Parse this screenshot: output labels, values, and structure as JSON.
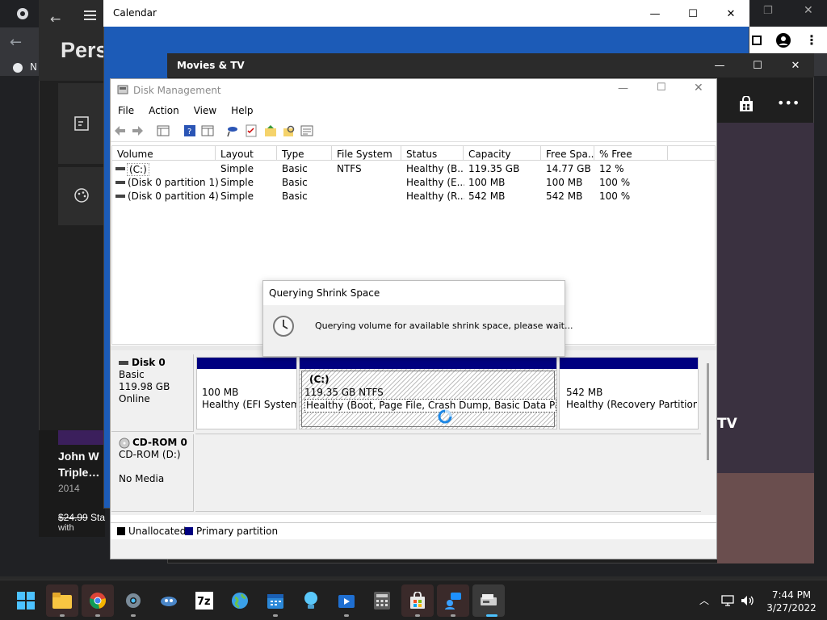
{
  "background": {
    "settings_title": "Pers",
    "settings_nav_letter": "N",
    "movie_card": {
      "title_line1": "John W",
      "title_line2": "Triple…",
      "year": "2014",
      "price": "$24.99",
      "price_suffix": "Sta",
      "with": "with"
    }
  },
  "calendar": {
    "title": "Calendar"
  },
  "movies": {
    "title": "Movies & TV",
    "poster_text": "TV"
  },
  "disk_management": {
    "title": "Disk Management",
    "menu": [
      "File",
      "Action",
      "View",
      "Help"
    ],
    "columns": [
      "Volume",
      "Layout",
      "Type",
      "File System",
      "Status",
      "Capacity",
      "Free Spa...",
      "% Free"
    ],
    "rows": [
      [
        "(C:)",
        "Simple",
        "Basic",
        "NTFS",
        "Healthy (B...",
        "119.35 GB",
        "14.77 GB",
        "12 %"
      ],
      [
        "(Disk 0 partition 1)",
        "Simple",
        "Basic",
        "",
        "Healthy (E...",
        "100 MB",
        "100 MB",
        "100 %"
      ],
      [
        "(Disk 0 partition 4)",
        "Simple",
        "Basic",
        "",
        "Healthy (R...",
        "542 MB",
        "542 MB",
        "100 %"
      ]
    ],
    "disk0": {
      "name": "Disk 0",
      "type": "Basic",
      "size": "119.98 GB",
      "state": "Online",
      "partitions": [
        {
          "size": "100 MB",
          "status": "Healthy (EFI System P"
        },
        {
          "label": "(C:)",
          "size": "119.35 GB NTFS",
          "status": "Healthy (Boot, Page File, Crash Dump, Basic Data Partition)"
        },
        {
          "size": "542 MB",
          "status": "Healthy (Recovery Partition)"
        }
      ]
    },
    "cdrom0": {
      "name": "CD-ROM 0",
      "type": "CD-ROM (D:)",
      "state": "No Media"
    },
    "legend": {
      "unallocated": "Unallocated",
      "primary": "Primary partition"
    }
  },
  "dialog": {
    "title": "Querying Shrink Space",
    "message": "Querying volume for available shrink space, please wait..."
  },
  "clock": {
    "time": "7:44 PM",
    "date": "3/27/2022"
  },
  "colors": {
    "primary_partition": "#000080",
    "unallocated": "#000000",
    "taskbar": "#202020"
  }
}
